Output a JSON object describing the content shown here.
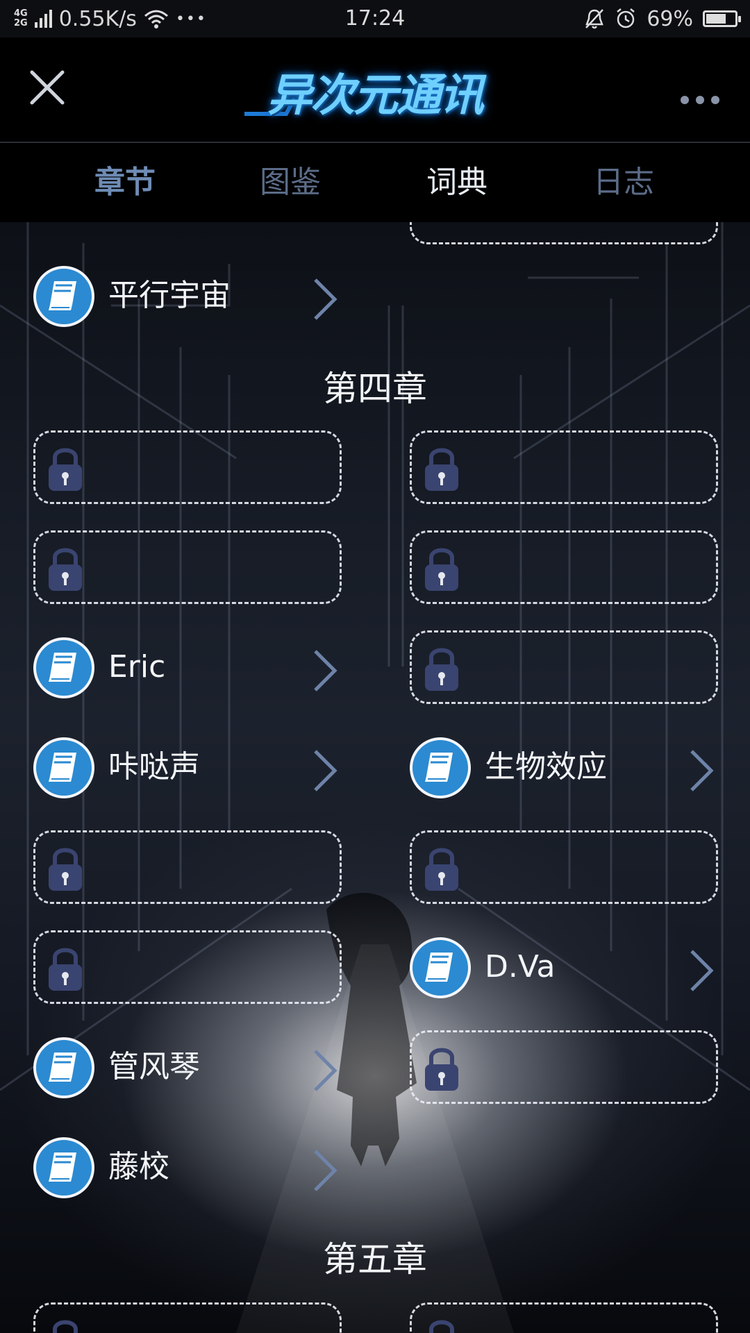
{
  "status_bar": {
    "network": [
      "4G",
      "2G"
    ],
    "speed": "0.55K/s",
    "dots": "•••",
    "time": "17:24",
    "battery_pct": "69%",
    "battery_level": 0.69
  },
  "header": {
    "logo_text": "异次元通讯",
    "close_icon": "close-icon",
    "more_icon": "more-dots-icon"
  },
  "tabs": [
    {
      "label": "章节"
    },
    {
      "label": "图鉴"
    },
    {
      "label": "词典"
    },
    {
      "label": "日志"
    }
  ],
  "active_tab": "词典",
  "sections": {
    "chapter4": "第四章",
    "chapter5": "第五章"
  },
  "entries": {
    "parallel": "平行宇宙",
    "eric": "Eric",
    "click": "咔哒声",
    "bio": "生物效应",
    "dva": "D.Va",
    "guanfengqin": "管风琴",
    "tengxiao": "藤校"
  },
  "colors": {
    "accent_blue": "#2b8ad1",
    "tab_inactive": "#5b6c88",
    "lock_purple": "#3a4470"
  }
}
